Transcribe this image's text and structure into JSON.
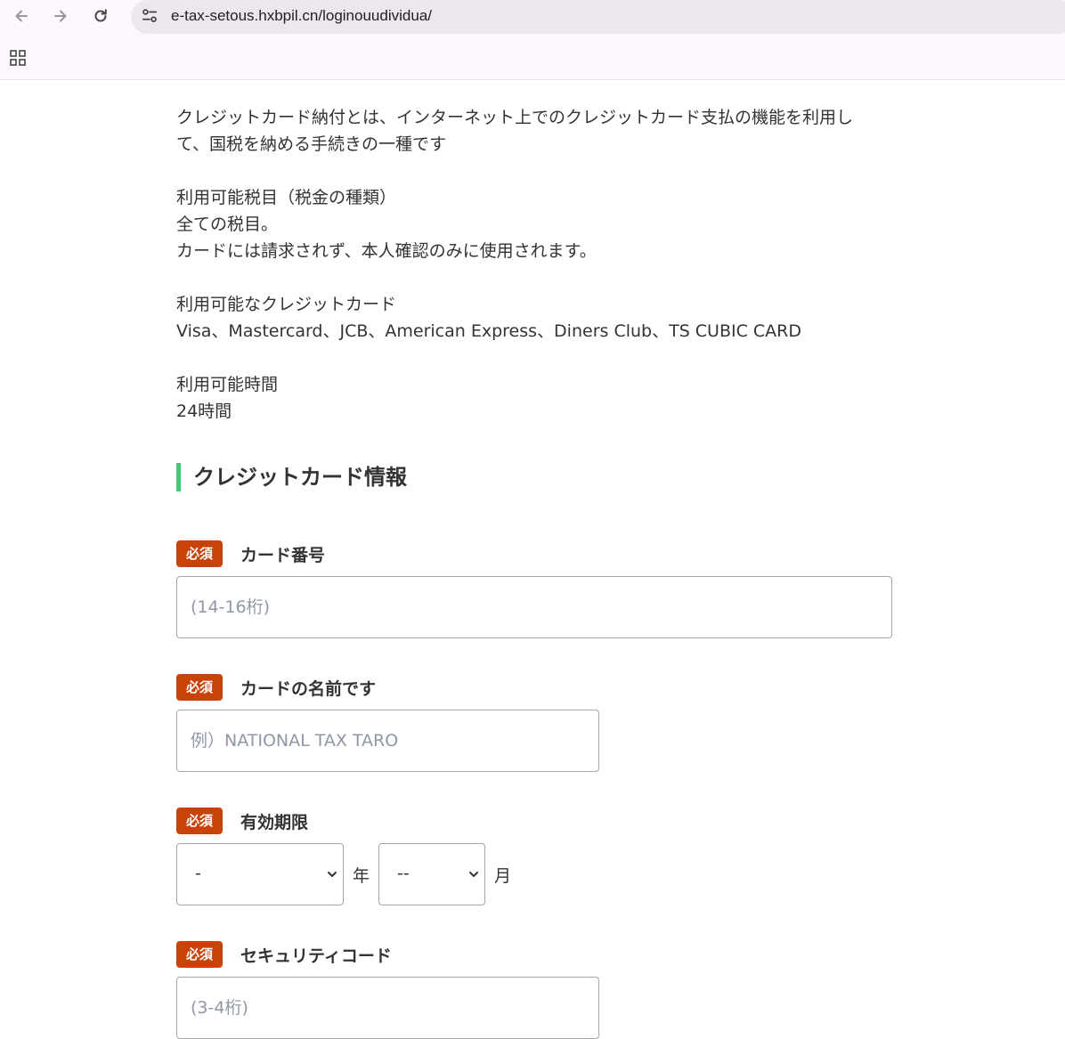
{
  "browser": {
    "url": "e-tax-setous.hxbpil.cn/loginouudividua/",
    "icons": [
      "back-arrow-icon",
      "forward-arrow-icon",
      "reload-icon",
      "site-settings-icon",
      "apps-grid-icon"
    ]
  },
  "intro": {
    "line1": "クレジットカード納付とは、インターネット上でのクレジットカード支払の機能を利用し",
    "line2": "て、国税を納める手続きの一種です",
    "tax_heading": "利用可能税目（税金の種類）",
    "tax_value": "全ての税目。",
    "tax_note": "カードには請求されず、本人確認のみに使用されます。",
    "cards_heading": "利用可能なクレジットカード",
    "cards_value": "Visa、Mastercard、JCB、American Express、Diners Club、TS CUBIC CARD",
    "hours_heading": "利用可能時間",
    "hours_value": "24時間"
  },
  "section_title": "クレジットカード情報",
  "colors": {
    "accent_bar": "#3fcc7a",
    "required_badge": "#c8420a"
  },
  "form": {
    "card_number": {
      "badge": "必須",
      "label": "カード番号",
      "placeholder": "(14-16桁)"
    },
    "card_name": {
      "badge": "必須",
      "label": "カードの名前です",
      "placeholder": "例）NATIONAL TAX TARO"
    },
    "expiry": {
      "badge": "必須",
      "label": "有効期限",
      "year_value": "-",
      "year_unit": "年",
      "month_value": "--",
      "month_unit": "月"
    },
    "security_code": {
      "badge": "必須",
      "label": "セキュリティコード",
      "placeholder": "(3-4桁)"
    }
  }
}
